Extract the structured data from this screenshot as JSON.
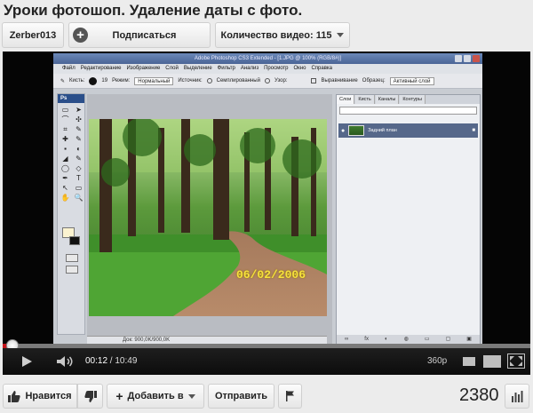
{
  "video": {
    "title": "Уроки фотошоп. Удаление даты с фото.",
    "channel": "Zerber013",
    "subscribe_label": "Подписаться",
    "videos_label": "Количество видео: 115"
  },
  "screen": {
    "window_title": "Adobe Photoshop CS3 Extended - [1.JPG @ 100% (RGB/8#)]",
    "menu": [
      "Файл",
      "Редактирование",
      "Изображение",
      "Слой",
      "Выделение",
      "Фильтр",
      "Анализ",
      "Просмотр",
      "Окно",
      "Справка"
    ],
    "options": {
      "brush_label": "Кисть:",
      "brush_size": "19",
      "mode_label": "Режим:",
      "mode_value": "Нормальный",
      "source_label": "Источник:",
      "source_sampled": "Семплированный",
      "source_pattern": "Узор:",
      "aligned": "Выравнивание",
      "sample_label": "Образец:",
      "sample_value": "Активный слой"
    },
    "tool_glyphs": [
      "▭",
      "➤",
      "⌒",
      "✣",
      "⌗",
      "✎",
      "✚",
      "✎",
      "▪",
      "◐",
      "◢",
      "✎",
      "◯",
      "◇",
      "✒",
      "T",
      "↖",
      "▭",
      "✋",
      "🔍"
    ],
    "layers_tabs": [
      "Слои",
      "Кисть",
      "Каналы",
      "Контуры"
    ],
    "layer_name": "Задний план",
    "date_stamp": "06/02/2006",
    "status_text": "Док: 900,0K/900,0K"
  },
  "player": {
    "progress": 0.018,
    "loaded": 1.0,
    "current_time": "00:12",
    "separator": " / ",
    "duration": "10:49",
    "quality": "360p"
  },
  "actions": {
    "like_label": "Нравится",
    "add_label": "Добавить в",
    "share_label": "Отправить",
    "views": "2380"
  },
  "icons": {
    "play": "play-icon",
    "volume": "volume-icon",
    "like": "thumbs-up-icon",
    "dislike": "thumbs-down-icon",
    "flag": "flag-icon",
    "stats": "stats-icon"
  },
  "colors": {
    "progress_played": "#c4151b",
    "date_stamp": "#f6e23c"
  }
}
